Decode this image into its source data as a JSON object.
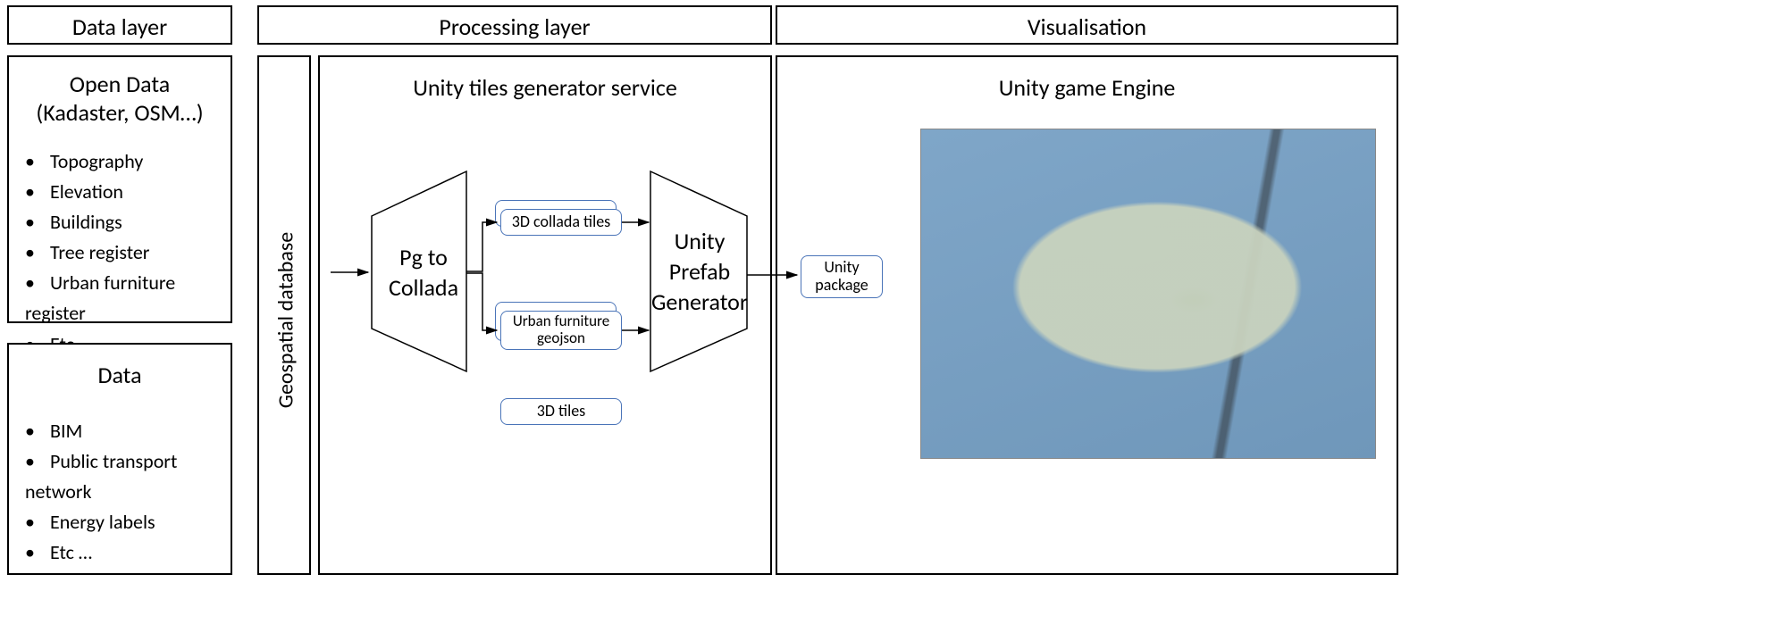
{
  "headers": {
    "data_layer": "Data layer",
    "processing_layer": "Processing layer",
    "visualisation": "Visualisation"
  },
  "open_data": {
    "title_l1": "Open Data",
    "title_l2": "(Kadaster, OSM…)",
    "items": [
      "Topography",
      "Elevation",
      "Buildings",
      "Tree register",
      "Urban furniture register",
      "Etc …"
    ]
  },
  "data_box": {
    "title": "Data",
    "items": [
      "BIM",
      "Public transport network",
      "Energy labels",
      "Etc …"
    ]
  },
  "processing": {
    "geospatial_db": "Geospatial database",
    "unity_tiles_service": "Unity tiles generator service",
    "pg_to_collada_l1": "Pg to",
    "pg_to_collada_l2": "Collada",
    "collada_tiles": "3D collada tiles",
    "urban_furniture_l1": "Urban furniture",
    "urban_furniture_l2": "geojson",
    "unity_prefab_l1": "Unity",
    "unity_prefab_l2": "Prefab",
    "unity_prefab_l3": "Generator",
    "tiles_3d": "3D tiles",
    "unity_package_l1": "Unity",
    "unity_package_l2": "package"
  },
  "visualisation": {
    "engine_title": "Unity game Engine"
  }
}
